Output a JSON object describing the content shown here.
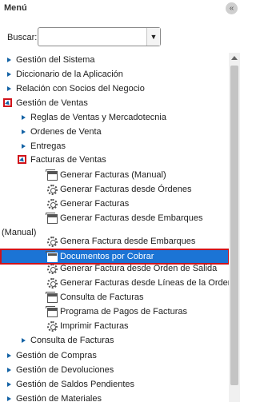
{
  "panel": {
    "title": "Menú",
    "collapse_icon": "double-chevron-left-icon"
  },
  "search": {
    "label": "Buscar:",
    "value": "",
    "dropdown_icon": "caret-down-icon"
  },
  "tree": [
    {
      "label": "Gestión del Sistema"
    },
    {
      "label": "Diccionario de la Aplicación"
    },
    {
      "label": "Relación con Socios del Negocio"
    },
    {
      "label": "Gestión de Ventas"
    },
    {
      "label": "Reglas de Ventas y Mercadotecnia"
    },
    {
      "label": "Ordenes de Venta"
    },
    {
      "label": "Entregas"
    },
    {
      "label": "Facturas de Ventas"
    },
    {
      "label": "Generar Facturas (Manual)"
    },
    {
      "label": "Generar Facturas desde Órdenes"
    },
    {
      "label": "Generar Facturas"
    },
    {
      "label": "Generar Facturas desde Embarques"
    },
    {
      "label": "(Manual)"
    },
    {
      "label": "Genera Factura desde Embarques"
    },
    {
      "label": "Documentos por Cobrar"
    },
    {
      "label": "Generar Factura desde Orden de Salida"
    },
    {
      "label": "Generar Facturas desde Líneas de la Orden"
    },
    {
      "label": "Consulta de Facturas"
    },
    {
      "label": "Programa de Pagos de Facturas"
    },
    {
      "label": "Imprimir Facturas"
    },
    {
      "label": "Consulta de Facturas"
    },
    {
      "label": "Gestión de Compras"
    },
    {
      "label": "Gestión de Devoluciones"
    },
    {
      "label": "Gestión de Saldos Pendientes"
    },
    {
      "label": "Gestión de Materiales"
    }
  ],
  "colors": {
    "accent": "#1b74d5",
    "highlight_border": "#d0121a",
    "expander": "#1463a5"
  }
}
